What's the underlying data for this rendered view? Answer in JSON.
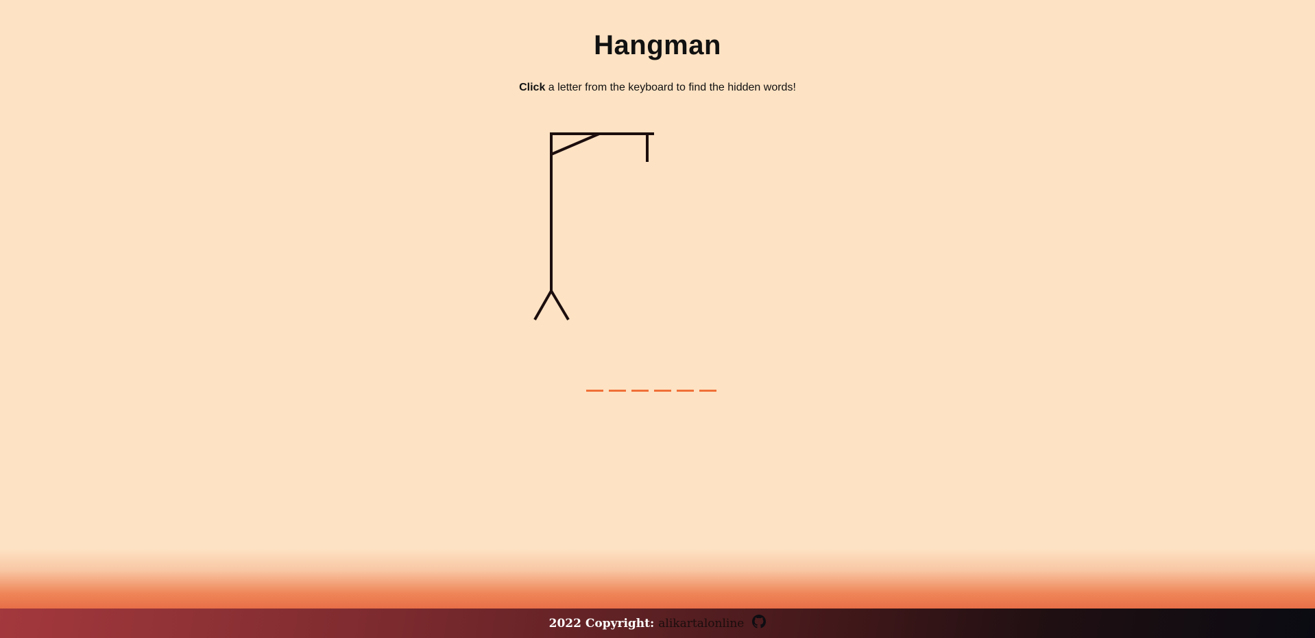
{
  "header": {
    "title": "Hangman",
    "instruction_bold": "Click",
    "instruction_rest": "a letter from the keyboard to find the hidden words!"
  },
  "game": {
    "word_slots": [
      "",
      "",
      "",
      "",
      "",
      ""
    ],
    "slot_color": "#f07039",
    "gallows_color": "#1c0e0e"
  },
  "footer": {
    "copyright": "2022 Copyright:",
    "author_link": "alikartalonline",
    "icon": "github-icon"
  },
  "colors": {
    "background": "#fde2c3",
    "accent": "#f07039"
  }
}
